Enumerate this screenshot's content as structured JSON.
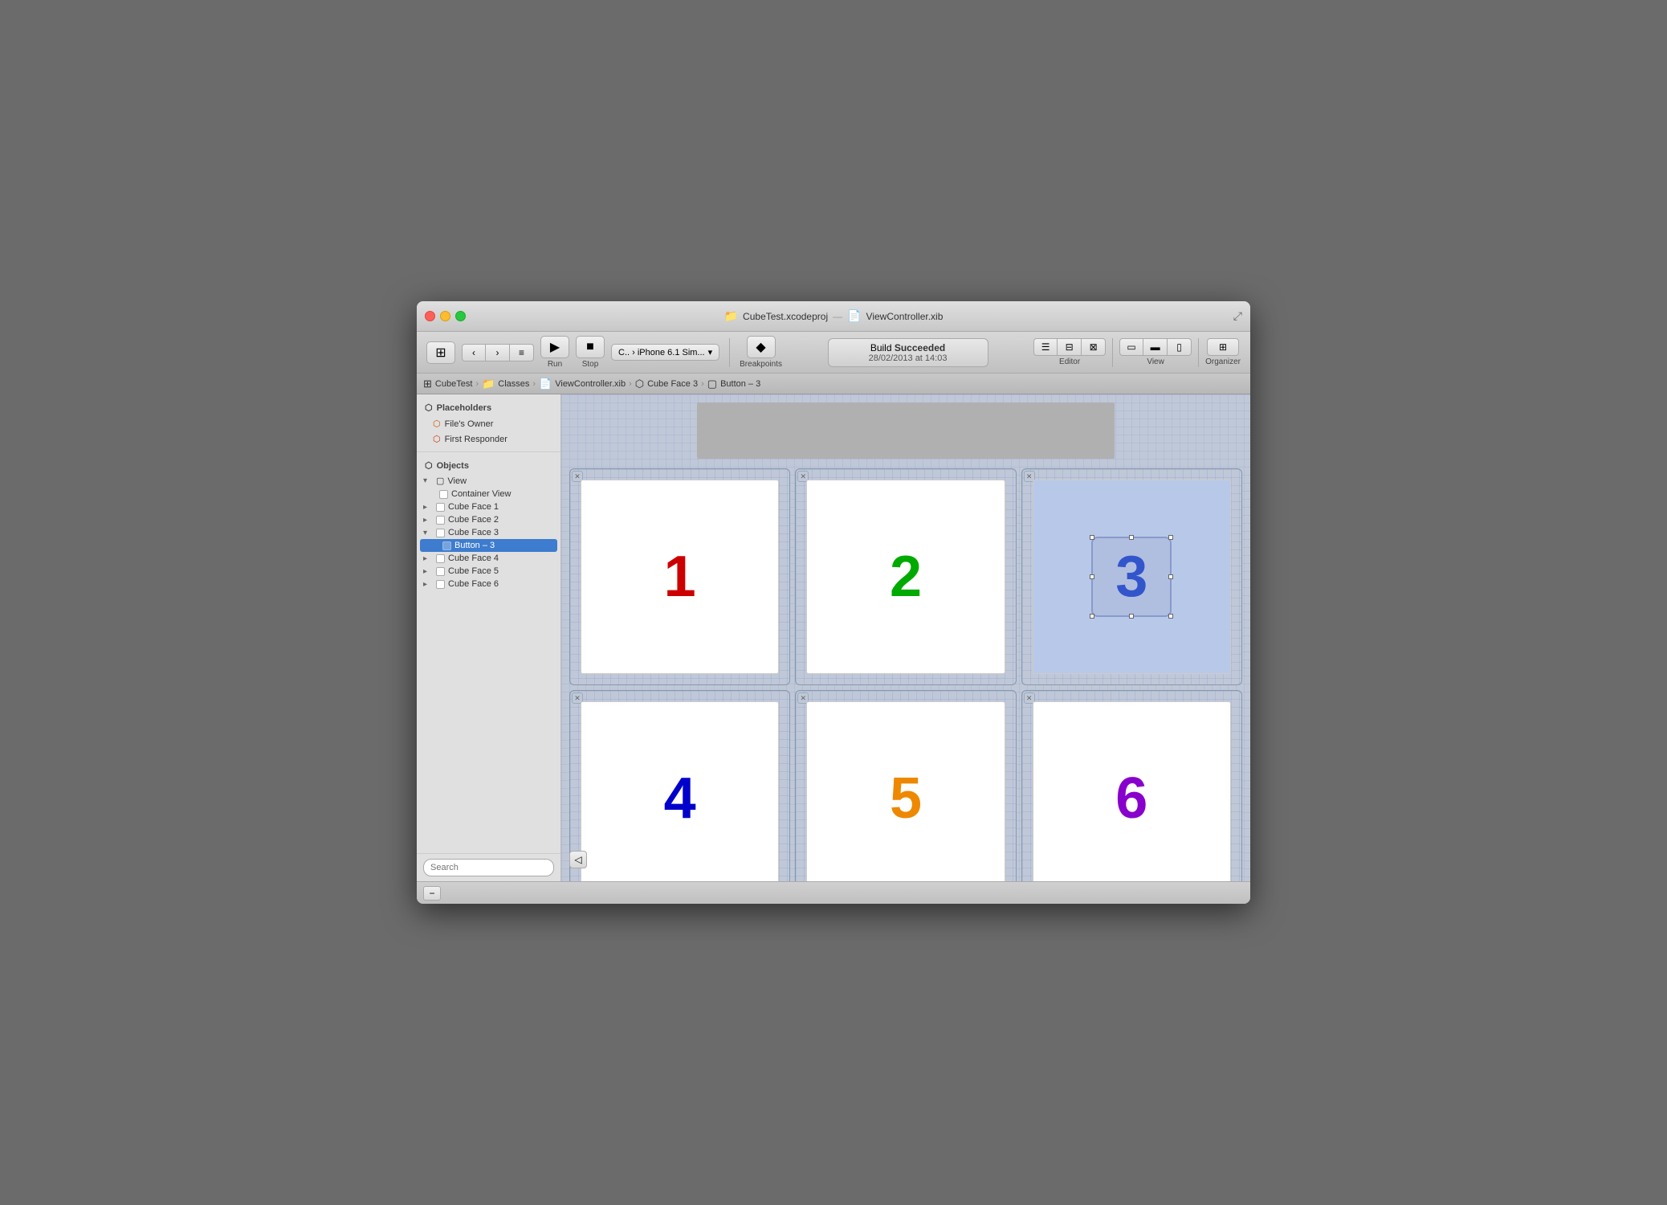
{
  "window": {
    "title_left": "CubeTest.xcodeproj",
    "title_right": "ViewController.xib"
  },
  "titlebar": {
    "left_file_icon": "📄",
    "left_title": "CubeTest.xcodeproj",
    "separator": "—",
    "right_file_icon": "📄",
    "right_title": "ViewController.xib",
    "resize_icon": "⤢"
  },
  "toolbar": {
    "run_label": "Run",
    "stop_label": "Stop",
    "scheme_label": "C.. › iPhone 6.1 Sim...",
    "breakpoints_label": "Breakpoints",
    "build_status": "Build",
    "build_status_bold": "Succeeded",
    "build_date": "28/02/2013 at 14:03",
    "editor_label": "Editor",
    "view_label": "View",
    "organizer_label": "Organizer"
  },
  "breadcrumb": {
    "items": [
      "CubeTest",
      "Classes",
      "ViewController.xib",
      "Cube Face 3",
      "Button – 3"
    ]
  },
  "sidebar": {
    "placeholders_header": "Placeholders",
    "files_owner": "File's Owner",
    "first_responder": "First Responder",
    "objects_header": "Objects",
    "tree": [
      {
        "label": "View",
        "level": 0,
        "expanded": true,
        "has_toggle": true
      },
      {
        "label": "Container View",
        "level": 1,
        "expanded": false,
        "has_checkbox": true
      },
      {
        "label": "Cube Face 1",
        "level": 0,
        "expanded": false,
        "has_toggle": true,
        "has_checkbox": true
      },
      {
        "label": "Cube Face 2",
        "level": 0,
        "expanded": false,
        "has_toggle": true,
        "has_checkbox": true
      },
      {
        "label": "Cube Face 3",
        "level": 0,
        "expanded": true,
        "has_toggle": true,
        "has_checkbox": true
      },
      {
        "label": "Button – 3",
        "level": 1,
        "selected": true,
        "has_checkbox": true
      },
      {
        "label": "Cube Face 4",
        "level": 0,
        "expanded": false,
        "has_toggle": true,
        "has_checkbox": true
      },
      {
        "label": "Cube Face 5",
        "level": 0,
        "expanded": false,
        "has_toggle": true,
        "has_checkbox": true
      },
      {
        "label": "Cube Face 6",
        "level": 0,
        "expanded": false,
        "has_toggle": true,
        "has_checkbox": true
      }
    ]
  },
  "canvas": {
    "faces": [
      {
        "number": "1",
        "color_class": "c1"
      },
      {
        "number": "2",
        "color_class": "c2"
      },
      {
        "number": "3",
        "color_class": "c3",
        "selected": true
      },
      {
        "number": "4",
        "color_class": "c4"
      },
      {
        "number": "5",
        "color_class": "c5"
      },
      {
        "number": "6",
        "color_class": "c6"
      }
    ]
  },
  "icons": {
    "run": "▶",
    "stop": "■",
    "breakpoints": "◆",
    "close_x": "✕",
    "chevron_right": "›",
    "triangle_down": "▾",
    "triangle_right": "▸",
    "cube_icon": "⬡",
    "file_icon": "📄",
    "grid_icon": "⊞"
  }
}
